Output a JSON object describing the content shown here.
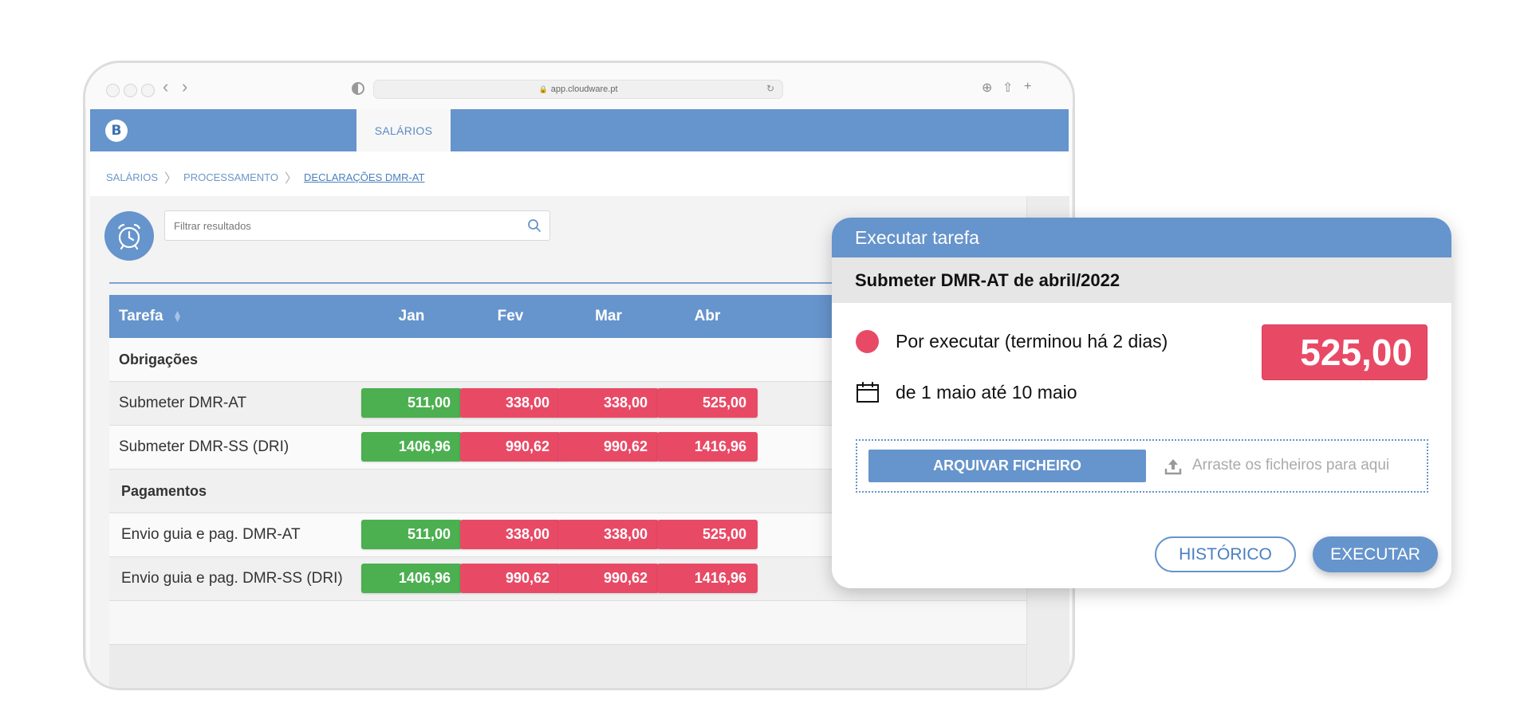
{
  "browser": {
    "url": "app.cloudware.pt"
  },
  "app": {
    "logo_letter": "B",
    "active_tab": "SALÁRIOS"
  },
  "breadcrumb": [
    "SALÁRIOS",
    "PROCESSAMENTO",
    "DECLARAÇÕES DMR-AT"
  ],
  "search": {
    "placeholder": "Filtrar resultados"
  },
  "table": {
    "headers": [
      "Tarefa",
      "Jan",
      "Fev",
      "Mar",
      "Abr"
    ],
    "groups": [
      {
        "name": "Obrigações",
        "rows": [
          {
            "task": "Submeter DMR-AT",
            "values": [
              "511,00",
              "338,00",
              "338,00",
              "525,00"
            ],
            "status": [
              "green",
              "red",
              "red",
              "red"
            ]
          },
          {
            "task": "Submeter DMR-SS (DRI)",
            "values": [
              "1406,96",
              "990,62",
              "990,62",
              "1416,96"
            ],
            "status": [
              "green",
              "red",
              "red",
              "red"
            ]
          }
        ]
      },
      {
        "name": "Pagamentos",
        "rows": [
          {
            "task": "Envio guia e pag. DMR-AT",
            "values": [
              "511,00",
              "338,00",
              "338,00",
              "525,00"
            ],
            "status": [
              "green",
              "red",
              "red",
              "red"
            ]
          },
          {
            "task": "Envio guia e pag. DMR-SS (DRI)",
            "values": [
              "1406,96",
              "990,62",
              "990,62",
              "1416,96"
            ],
            "status": [
              "green",
              "red",
              "red",
              "red"
            ]
          }
        ]
      }
    ]
  },
  "modal": {
    "title": "Executar tarefa",
    "subtitle": "Submeter DMR-AT de abril/2022",
    "status_text": "Por executar (terminou há 2 dias)",
    "amount": "525,00",
    "period": "de 1 maio até 10 maio",
    "upload_button": "ARQUIVAR FICHEIRO",
    "drop_hint": "Arraste os ficheiros para aqui",
    "history_button": "HISTÓRICO",
    "execute_button": "EXECUTAR"
  },
  "colors": {
    "primary": "#6694cc",
    "paid": "#4caf50",
    "unpaid": "#e84a66"
  }
}
